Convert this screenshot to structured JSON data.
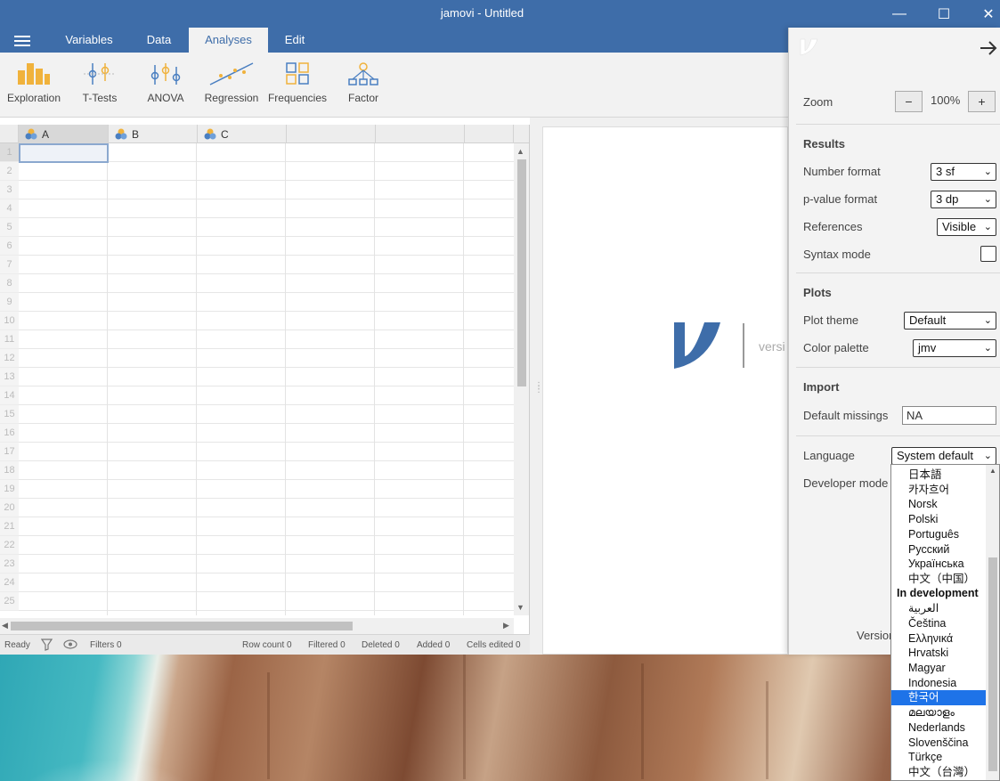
{
  "window": {
    "title": "jamovi - Untitled",
    "minimize": "—",
    "maximize": "☐",
    "close": "✕"
  },
  "tabs": [
    "Variables",
    "Data",
    "Analyses",
    "Edit"
  ],
  "ribbon": [
    "Exploration",
    "T-Tests",
    "ANOVA",
    "Regression",
    "Frequencies",
    "Factor"
  ],
  "columns": [
    "A",
    "B",
    "C"
  ],
  "row_numbers": [
    "1",
    "2",
    "3",
    "4",
    "5",
    "6",
    "7",
    "8",
    "9",
    "10",
    "11",
    "12",
    "13",
    "14",
    "15",
    "16",
    "17",
    "18",
    "19",
    "20",
    "21",
    "22",
    "23",
    "24",
    "25"
  ],
  "status": {
    "ready": "Ready",
    "filters": "Filters 0",
    "row_count": "Row count 0",
    "filtered": "Filtered 0",
    "deleted": "Deleted 0",
    "added": "Added 0",
    "cells_edited": "Cells edited 0"
  },
  "results": {
    "version_text": "versi"
  },
  "settings": {
    "zoom_label": "Zoom",
    "zoom_minus": "−",
    "zoom_value": "100%",
    "zoom_plus": "+",
    "results_heading": "Results",
    "number_format_label": "Number format",
    "number_format_value": "3 sf",
    "pvalue_format_label": "p-value format",
    "pvalue_format_value": "3 dp",
    "references_label": "References",
    "references_value": "Visible",
    "syntax_mode_label": "Syntax mode",
    "plots_heading": "Plots",
    "plot_theme_label": "Plot theme",
    "plot_theme_value": "Default",
    "color_palette_label": "Color palette",
    "color_palette_value": "jmv",
    "import_heading": "Import",
    "default_missings_label": "Default missings",
    "default_missings_value": "NA",
    "language_label": "Language",
    "language_value": "System default",
    "developer_mode_label": "Developer mode",
    "version_label": "Version"
  },
  "language_options": {
    "top": [
      "日本語",
      "카자흐어",
      "Norsk",
      "Polski",
      "Português",
      "Русский",
      "Українська",
      "中文（中国）"
    ],
    "group_label": "In development",
    "dev": [
      "العربية",
      "Čeština",
      "Ελληνικά",
      "Hrvatski",
      "Magyar",
      "Indonesia",
      "한국어",
      "മലയാളം",
      "Nederlands",
      "Slovenščina",
      "Türkçe",
      "中文（台灣）"
    ],
    "highlighted": "한국어"
  },
  "colors": {
    "accent": "#3e6da9",
    "highlight": "#1e73e8"
  }
}
